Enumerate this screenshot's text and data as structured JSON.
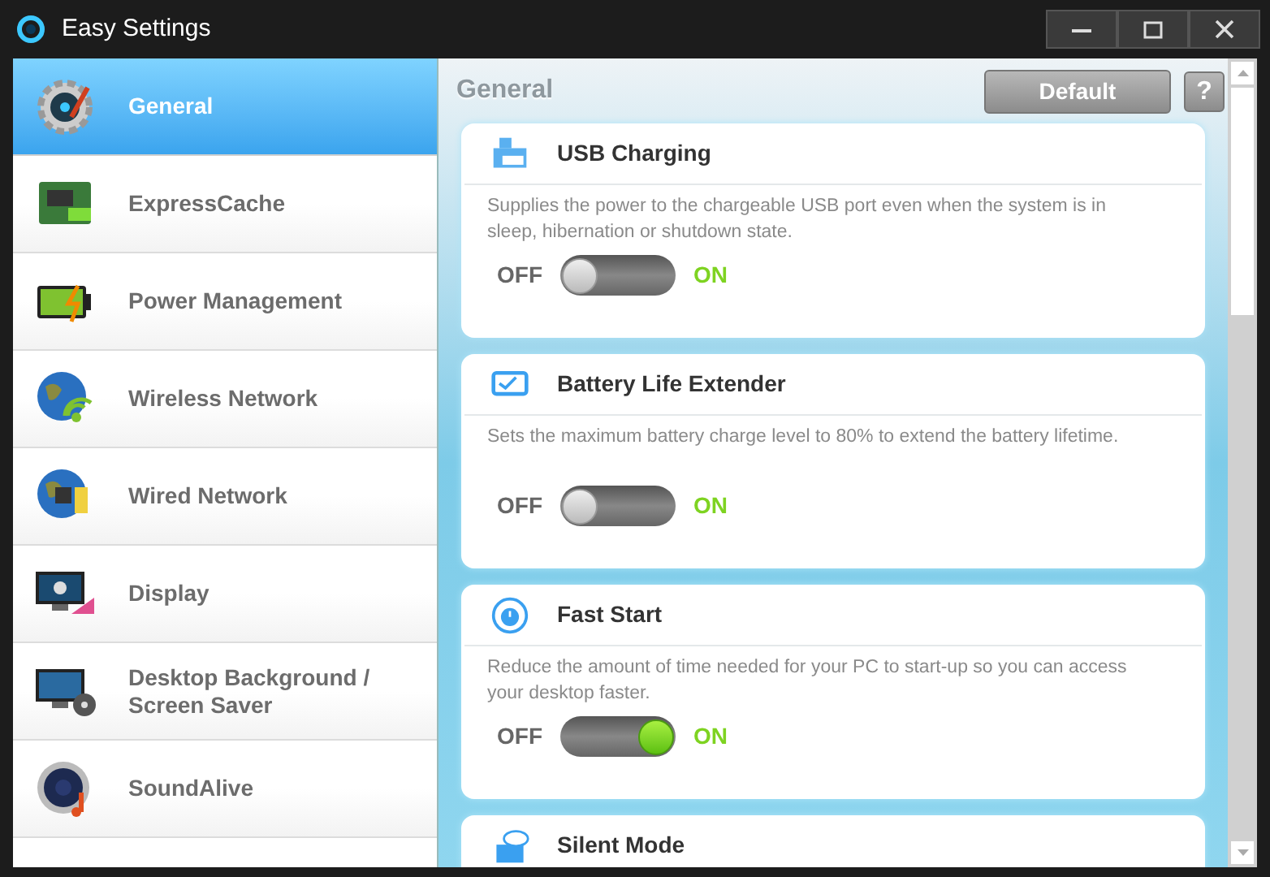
{
  "window": {
    "title": "Easy Settings"
  },
  "sidebar": {
    "items": [
      {
        "label": "General",
        "selected": true
      },
      {
        "label": "ExpressCache",
        "selected": false
      },
      {
        "label": "Power Management",
        "selected": false
      },
      {
        "label": "Wireless Network",
        "selected": false
      },
      {
        "label": "Wired Network",
        "selected": false
      },
      {
        "label": "Display",
        "selected": false
      },
      {
        "label": "Desktop Background / Screen Saver",
        "selected": false
      },
      {
        "label": "SoundAlive",
        "selected": false
      }
    ]
  },
  "content": {
    "heading": "General",
    "default_button": "Default",
    "help_button": "?",
    "settings": [
      {
        "title": "USB Charging",
        "description": "Supplies the power to the chargeable USB port even when the system is in sleep, hibernation or shutdown state.",
        "off_label": "OFF",
        "on_label": "ON",
        "on": false
      },
      {
        "title": "Battery Life Extender",
        "description": "Sets the maximum battery charge level to 80% to extend the battery lifetime.",
        "off_label": "OFF",
        "on_label": "ON",
        "on": false
      },
      {
        "title": "Fast Start",
        "description": "Reduce the amount of time needed for your PC to start-up so you can access your desktop faster.",
        "off_label": "OFF",
        "on_label": "ON",
        "on": true
      },
      {
        "title": "Silent Mode"
      }
    ]
  }
}
